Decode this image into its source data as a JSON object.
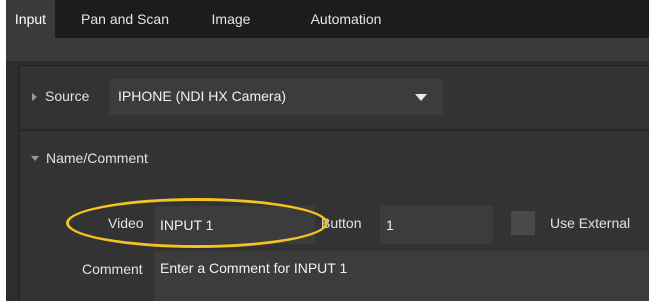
{
  "tabs": [
    {
      "label": "Input",
      "active": true
    },
    {
      "label": "Pan and Scan",
      "active": false
    },
    {
      "label": "Image",
      "active": false
    },
    {
      "label": "Automation",
      "active": false
    }
  ],
  "source": {
    "label": "Source",
    "selected": "IPHONE (NDI HX Camera)"
  },
  "name_comment": {
    "section_label": "Name/Comment",
    "video_label": "Video",
    "video_value": "INPUT 1",
    "button_label": "Button",
    "button_value": "1",
    "use_external_label": "Use External",
    "comment_label": "Comment",
    "comment_placeholder": "Enter a Comment for INPUT 1"
  },
  "colors": {
    "accent_highlight": "#f5c223",
    "background": "#2d2d2d"
  }
}
